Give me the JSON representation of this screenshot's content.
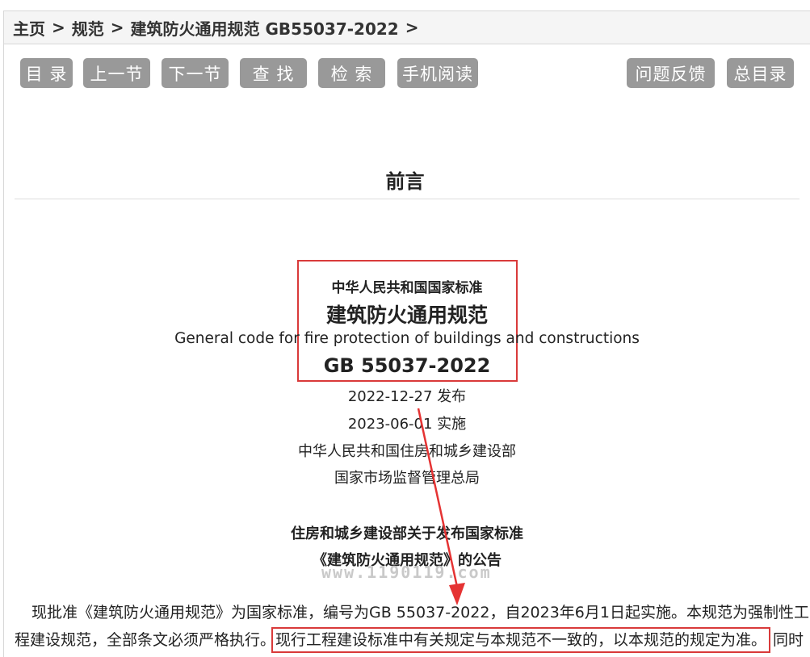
{
  "breadcrumb": {
    "home": "主页",
    "separator": ">",
    "category": "规范",
    "current": "建筑防火通用规范 GB55037-2022"
  },
  "toolbar": {
    "toc": "目 录",
    "prev": "上一节",
    "next": "下一节",
    "find": "查 找",
    "search": "检 索",
    "mobile": "手机阅读",
    "feedback": "问题反馈",
    "master_toc": "总目录"
  },
  "section": {
    "title": "前言"
  },
  "standard": {
    "issuer_line": "中华人民共和国国家标准",
    "name_cn": "建筑防火通用规范",
    "name_en": "General code for fire protection of buildings and constructions",
    "code": "GB 55037-2022",
    "issue_date": "2022-12-27 发布",
    "effective_date": "2023-06-01 实施",
    "issuer_1": "中华人民共和国住房和城乡建设部",
    "issuer_2": "国家市场监督管理总局"
  },
  "announcement": {
    "title_1": "住房和城乡建设部关于发布国家标准",
    "title_2": "《建筑防火通用规范》的公告",
    "watermark": "www.1190119.com",
    "para_line1": "现批准《建筑防火通用规范》为国家标准，编号为GB 55037-2022，自2023年6月1日起实施。本规范为强制性工",
    "para_line2_a": "程建设规范，全部条文必须严格执行。",
    "para_line2_highlight": "现行工程建设标准中有关规定与本规范不一致的，以本规范的规定为准。",
    "para_line2_b": "同时"
  },
  "colors": {
    "button_bg": "#999999",
    "highlight_red": "#d93a3a"
  }
}
